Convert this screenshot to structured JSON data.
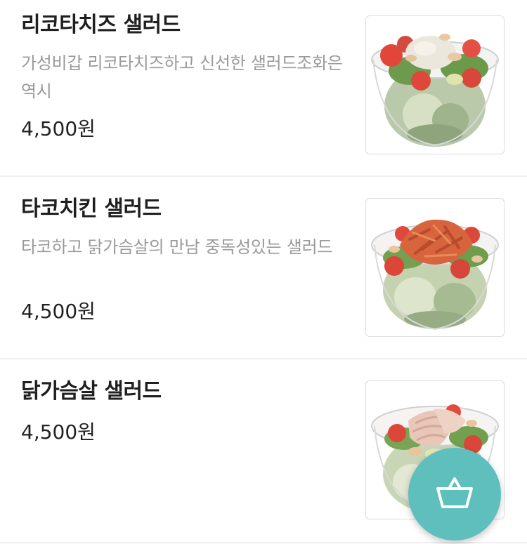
{
  "menu": {
    "items": [
      {
        "name": "리코타치즈 샐러드",
        "description": "가성비갑 리코타치즈하고 신선한 샐러드조화은 역시",
        "price": "4,500원",
        "image": "ricotta-salad-image"
      },
      {
        "name": "타코치킨 샐러드",
        "description": "타코하고 닭가슴살의 만남 중독성있는 샐러드",
        "price": "4,500원",
        "image": "taco-chicken-salad-image"
      },
      {
        "name": "닭가슴살 샐러드",
        "price": "4,500원",
        "image": "chicken-breast-salad-image"
      }
    ]
  },
  "cart_button": {
    "icon": "basket-icon",
    "color": "#5ebfbd"
  }
}
